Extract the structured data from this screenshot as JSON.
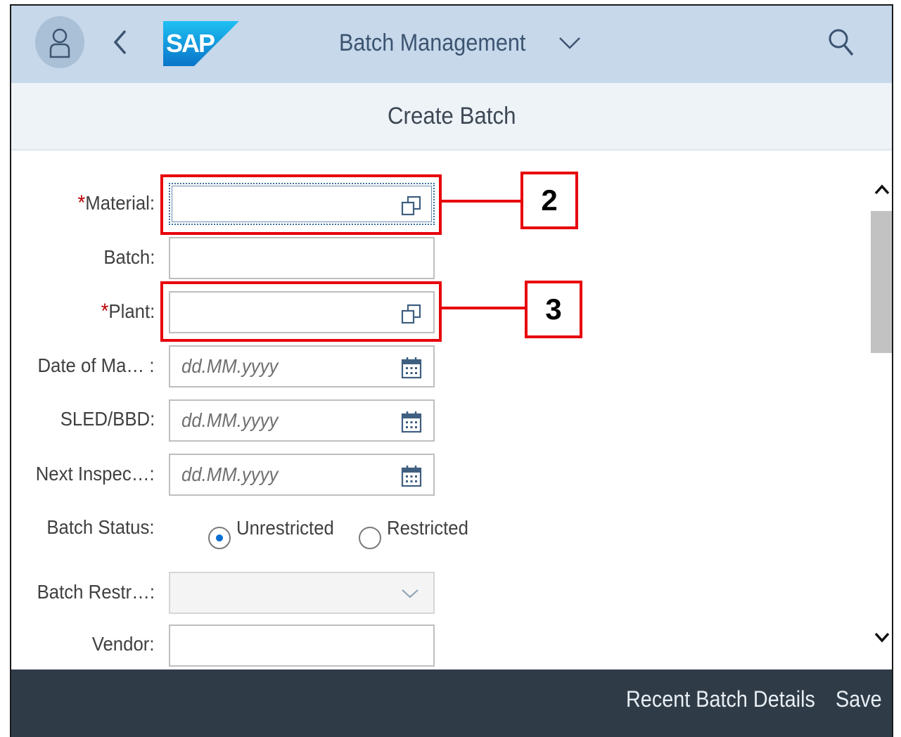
{
  "shell": {
    "logo_text": "SAP",
    "app_title": "Batch Management"
  },
  "page": {
    "title": "Create Batch"
  },
  "form": {
    "material": {
      "label": "Material:",
      "required_mark": "*",
      "value": ""
    },
    "batch": {
      "label": "Batch:",
      "value": ""
    },
    "plant": {
      "label": "Plant:",
      "required_mark": "*",
      "value": ""
    },
    "date_of_manufacture": {
      "label": "Date of Ma… :",
      "placeholder": "dd.MM.yyyy"
    },
    "sled_bbd": {
      "label": "SLED/BBD:",
      "placeholder": "dd.MM.yyyy"
    },
    "next_inspection": {
      "label": "Next Inspec…:",
      "placeholder": "dd.MM.yyyy"
    },
    "batch_status": {
      "label": "Batch Status:",
      "options": [
        "Unrestricted",
        "Restricted"
      ],
      "selected": "Unrestricted"
    },
    "batch_restriction": {
      "label": "Batch Restr…:",
      "value": ""
    },
    "vendor": {
      "label": "Vendor:",
      "value": ""
    }
  },
  "annotations": {
    "callout_material": "2",
    "callout_plant": "3",
    "color": "#e8000b"
  },
  "footer": {
    "recent_label": "Recent Batch Details",
    "save_label": "Save"
  },
  "colors": {
    "shell_bg": "#c6d8ea",
    "footer_bg": "#2f3c48",
    "accent": "#0a6ed1",
    "required": "#bb0000"
  },
  "icons": [
    "user-icon",
    "back-arrow-icon",
    "sap-logo",
    "chevron-down-icon",
    "search-icon",
    "value-help-icon",
    "calendar-icon",
    "scroll-up-icon",
    "scroll-down-icon"
  ]
}
